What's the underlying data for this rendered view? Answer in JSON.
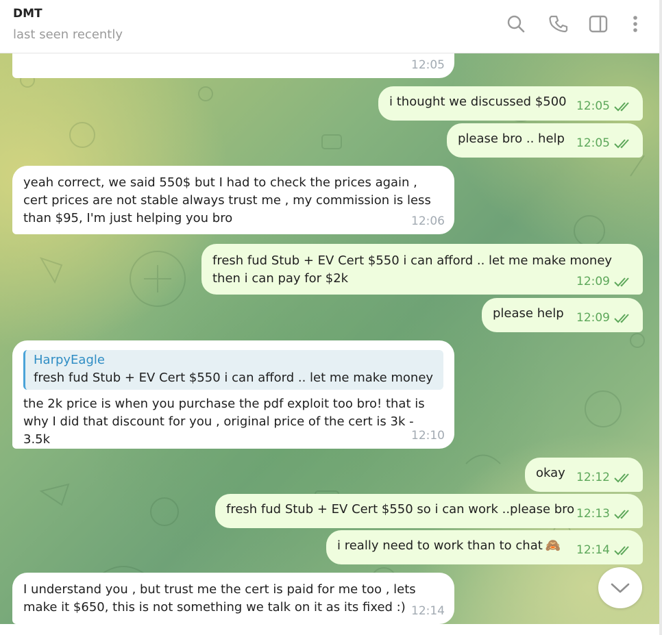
{
  "header": {
    "name": "DMT",
    "status": "last seen recently",
    "icons": [
      "search-icon",
      "phone-icon",
      "sidebar-toggle-icon",
      "more-vertical-icon"
    ]
  },
  "colors": {
    "incoming_bubble": "#ffffff",
    "outgoing_bubble": "#effdde",
    "outgoing_meta": "#5da75a",
    "incoming_meta": "#a2aab2",
    "reply_accent": "#4aa3d8"
  },
  "messages": [
    {
      "dir": "in",
      "text": "",
      "time": "12:05"
    },
    {
      "dir": "out",
      "text": "i thought we discussed $500",
      "time": "12:05"
    },
    {
      "dir": "out",
      "text": "please bro .. help",
      "time": "12:05"
    },
    {
      "dir": "in",
      "text": "yeah correct, we said 550$ but I had to check the prices again , cert prices are not stable always trust me , my commission is less than $95, I'm just helping you bro",
      "time": "12:06"
    },
    {
      "dir": "out",
      "text": "fresh fud Stub + EV Cert $550 i can afford .. let me make money then i can pay for $2k",
      "time": "12:09"
    },
    {
      "dir": "out",
      "text": "please help",
      "time": "12:09"
    },
    {
      "dir": "in",
      "reply_name": "HarpyEagle",
      "reply_text": "fresh fud Stub + EV Cert $550 i can afford .. let me make money ...",
      "text": "the 2k price is when you purchase the pdf exploit too bro! that is why I did that discount for you , original price of the cert is 3k - 3.5k",
      "time": "12:10"
    },
    {
      "dir": "out",
      "text": "okay",
      "time": "12:12"
    },
    {
      "dir": "out",
      "text": "fresh fud Stub + EV Cert $550 so i can work ..please bro",
      "time": "12:13"
    },
    {
      "dir": "out",
      "text": "i really need to work than to chat",
      "emoji": "🙈",
      "time": "12:14"
    },
    {
      "dir": "in",
      "text": "I understand you , but trust me the cert is paid for me too , lets make it $650, this is not something we talk on it as its fixed :)",
      "time": "12:14"
    }
  ]
}
